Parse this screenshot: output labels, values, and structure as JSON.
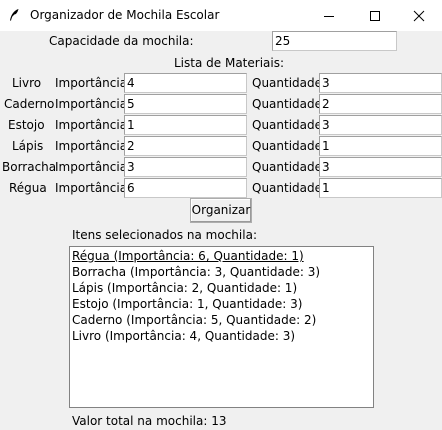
{
  "window": {
    "title": "Organizador de Mochila Escolar"
  },
  "capacity": {
    "label": "Capacidade da mochila:",
    "value": "25"
  },
  "materials_heading": "Lista de Materiais:",
  "materials": [
    {
      "name": "Livro",
      "importance_label": "Importância:",
      "importance": "4",
      "quantity_label": "Quantidade:",
      "quantity": "3"
    },
    {
      "name": "Caderno",
      "importance_label": "Importância:",
      "importance": "5",
      "quantity_label": "Quantidade:",
      "quantity": "2"
    },
    {
      "name": "Estojo",
      "importance_label": "Importância:",
      "importance": "1",
      "quantity_label": "Quantidade:",
      "quantity": "3"
    },
    {
      "name": "Lápis",
      "importance_label": "Importância:",
      "importance": "2",
      "quantity_label": "Quantidade:",
      "quantity": "1"
    },
    {
      "name": "Borracha",
      "importance_label": "Importância:",
      "importance": "3",
      "quantity_label": "Quantidade:",
      "quantity": "3"
    },
    {
      "name": "Régua",
      "importance_label": "Importância:",
      "importance": "6",
      "quantity_label": "Quantidade:",
      "quantity": "1"
    }
  ],
  "organize_button": "Organizar",
  "selected": {
    "label": "Itens selecionados na mochila:",
    "items": [
      "Régua (Importância: 6, Quantidade: 1)",
      "Borracha (Importância: 3, Quantidade: 3)",
      "Lápis (Importância: 2, Quantidade: 1)",
      "Estojo (Importância: 1, Quantidade: 3)",
      "Caderno (Importância: 5, Quantidade: 2)",
      "Livro (Importância: 4, Quantidade: 3)"
    ]
  },
  "total": "Valor total na mochila: 13"
}
